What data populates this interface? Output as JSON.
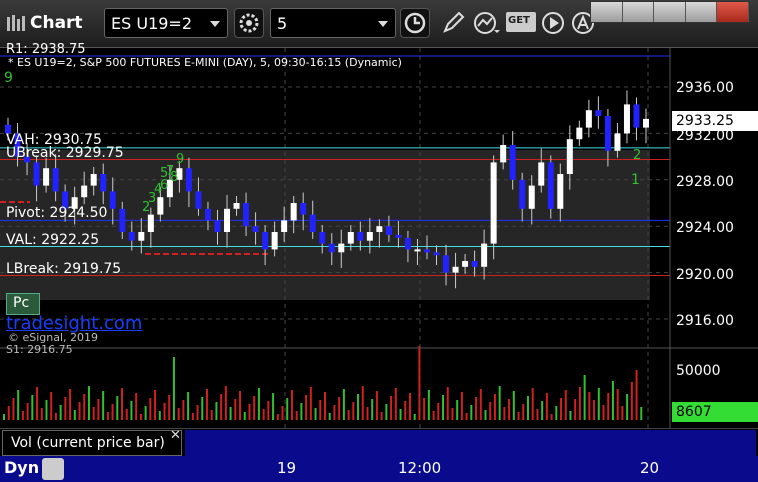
{
  "window": {
    "title": "Chart",
    "symbol": "ES U19=2",
    "interval": "5",
    "get_label": "GET"
  },
  "chart": {
    "description": "* ES U19=2, S&P 500 FUTURES E-MINI (DAY), 5, 09:30-16:15 (Dynamic)",
    "r1_label": "R1: 2938.75",
    "partial_top": "9",
    "levels": {
      "vah": "VAH: 2930.75",
      "ubreak": "UBreak: 2929.75",
      "pivot": "Pivot: 2924.50",
      "val": "VAL: 2922.25",
      "lbreak": "LBreak: 2919.75",
      "s1": "S1: 2916.75"
    },
    "pc_label": "Pc",
    "site": "tradesight.com",
    "copyright": "© eSignal, 2019",
    "price_axis": [
      "2936.00",
      "2932.00",
      "2928.00",
      "2924.00",
      "2920.00",
      "2916.00"
    ],
    "last_price": "2933.25",
    "volume_axis": [
      "50000"
    ],
    "last_volume": "8607",
    "volume_panel_label": "Vol (current price bar)",
    "x_ticks": [
      "19",
      "12:00",
      "20"
    ],
    "status": "Dyn",
    "td_counts": [
      "2",
      "3",
      "4",
      "5",
      "6",
      "7",
      "8",
      "9",
      "2",
      "1",
      "9"
    ],
    "colors": {
      "up_bar": "#2222ff",
      "down_bar": "#ffffff",
      "vah_line": "#40e0e0",
      "pivot_line": "#2030ff",
      "break_line": "#d02020",
      "volume_up": "#30c030",
      "volume_down": "#d02020",
      "last_volume_bg": "#33dd33",
      "status_bar": "#0a0a8c"
    }
  },
  "chart_data": {
    "type": "candlestick",
    "xlabel": "",
    "ylabel": "",
    "ylim": [
      2914.0,
      2939.0
    ],
    "x_ticks": [
      "19",
      "12:00",
      "20"
    ],
    "reference_lines": [
      {
        "name": "VAH",
        "value": 2930.75
      },
      {
        "name": "UBreak",
        "value": 2929.75
      },
      {
        "name": "Pivot",
        "value": 2924.5
      },
      {
        "name": "VAL",
        "value": 2922.25
      },
      {
        "name": "LBreak",
        "value": 2919.75
      }
    ],
    "series": [
      {
        "name": "ES U19=2",
        "close": [
          2932.0,
          2930.0,
          2929.5,
          2927.5,
          2929.0,
          2927.0,
          2925.5,
          2926.5,
          2927.5,
          2928.5,
          2927.0,
          2925.5,
          2923.5,
          2922.75,
          2923.5,
          2925.0,
          2926.5,
          2928.0,
          2929.0,
          2927.0,
          2925.5,
          2924.5,
          2923.5,
          2925.5,
          2926.0,
          2924.0,
          2923.5,
          2922.0,
          2923.5,
          2924.5,
          2926.0,
          2925.0,
          2923.5,
          2922.5,
          2921.75,
          2922.5,
          2923.5,
          2922.75,
          2923.5,
          2924.0,
          2923.25,
          2923.0,
          2922.0,
          2922.0,
          2921.75,
          2921.5,
          2920.0,
          2920.5,
          2921.0,
          2920.5,
          2922.5,
          2929.5,
          2931.0,
          2928.0,
          2925.5,
          2927.5,
          2929.5,
          2925.5,
          2928.5,
          2931.5,
          2932.5,
          2934.0,
          2933.5,
          2930.5,
          2932.0,
          2934.5,
          2932.5,
          2933.25
        ]
      }
    ],
    "volume": [
      8607
    ]
  }
}
